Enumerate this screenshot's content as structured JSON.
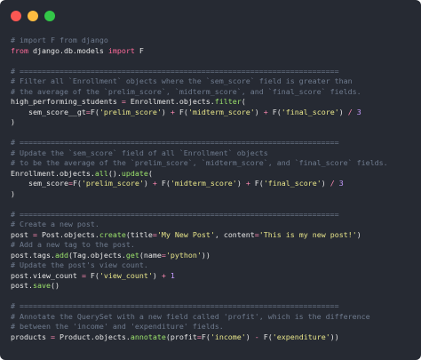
{
  "window": {
    "controls": [
      "close",
      "minimize",
      "maximize"
    ],
    "colors": {
      "close": "#fc5753",
      "minimize": "#fdbc40",
      "maximize": "#33c748",
      "background": "#262a33"
    }
  },
  "code_lines": [
    [
      {
        "t": "# import F from django",
        "c": "cm"
      }
    ],
    [
      {
        "t": "from",
        "c": "kw"
      },
      {
        "t": " django.db.models ",
        "c": "tx"
      },
      {
        "t": "import",
        "c": "kw"
      },
      {
        "t": " F",
        "c": "tx"
      }
    ],
    [],
    [
      {
        "t": "# ========================================================================",
        "c": "cm"
      }
    ],
    [
      {
        "t": "# Filter all `Enrollment` objects where the `sem_score` field is greater than",
        "c": "cm"
      }
    ],
    [
      {
        "t": "# the average of the `prelim_score`, `midterm_score`, and `final_score` fields.",
        "c": "cm"
      }
    ],
    [
      {
        "t": "high_performing_students ",
        "c": "tx"
      },
      {
        "t": "=",
        "c": "op"
      },
      {
        "t": " Enrollment.objects.",
        "c": "tx"
      },
      {
        "t": "filter",
        "c": "fn"
      },
      {
        "t": "(",
        "c": "tx"
      }
    ],
    [
      {
        "t": "    sem_score__gt",
        "c": "tx"
      },
      {
        "t": "=",
        "c": "op"
      },
      {
        "t": "F(",
        "c": "tx"
      },
      {
        "t": "'prelim_score'",
        "c": "str"
      },
      {
        "t": ") ",
        "c": "tx"
      },
      {
        "t": "+",
        "c": "op"
      },
      {
        "t": " F(",
        "c": "tx"
      },
      {
        "t": "'midterm_score'",
        "c": "str"
      },
      {
        "t": ") ",
        "c": "tx"
      },
      {
        "t": "+",
        "c": "op"
      },
      {
        "t": " F(",
        "c": "tx"
      },
      {
        "t": "'final_score'",
        "c": "str"
      },
      {
        "t": ") ",
        "c": "tx"
      },
      {
        "t": "/",
        "c": "op"
      },
      {
        "t": " ",
        "c": "tx"
      },
      {
        "t": "3",
        "c": "num"
      }
    ],
    [
      {
        "t": ")",
        "c": "tx"
      }
    ],
    [],
    [
      {
        "t": "# ========================================================================",
        "c": "cm"
      }
    ],
    [
      {
        "t": "# Update the `sem_score` field of all `Enrollment` objects",
        "c": "cm"
      }
    ],
    [
      {
        "t": "# to be the average of the `prelim_score`, `midterm_score`, and `final_score` fields.",
        "c": "cm"
      }
    ],
    [
      {
        "t": "Enrollment.objects.",
        "c": "tx"
      },
      {
        "t": "all",
        "c": "fn"
      },
      {
        "t": "().",
        "c": "tx"
      },
      {
        "t": "update",
        "c": "fn"
      },
      {
        "t": "(",
        "c": "tx"
      }
    ],
    [
      {
        "t": "    sem_score",
        "c": "tx"
      },
      {
        "t": "=",
        "c": "op"
      },
      {
        "t": "F(",
        "c": "tx"
      },
      {
        "t": "'prelim_score'",
        "c": "str"
      },
      {
        "t": ") ",
        "c": "tx"
      },
      {
        "t": "+",
        "c": "op"
      },
      {
        "t": " F(",
        "c": "tx"
      },
      {
        "t": "'midterm_score'",
        "c": "str"
      },
      {
        "t": ") ",
        "c": "tx"
      },
      {
        "t": "+",
        "c": "op"
      },
      {
        "t": " F(",
        "c": "tx"
      },
      {
        "t": "'final_score'",
        "c": "str"
      },
      {
        "t": ") ",
        "c": "tx"
      },
      {
        "t": "/",
        "c": "op"
      },
      {
        "t": " ",
        "c": "tx"
      },
      {
        "t": "3",
        "c": "num"
      }
    ],
    [
      {
        "t": ")",
        "c": "tx"
      }
    ],
    [],
    [
      {
        "t": "# ========================================================================",
        "c": "cm"
      }
    ],
    [
      {
        "t": "# Create a new post.",
        "c": "cm"
      }
    ],
    [
      {
        "t": "post ",
        "c": "tx"
      },
      {
        "t": "=",
        "c": "op"
      },
      {
        "t": " Post.objects.",
        "c": "tx"
      },
      {
        "t": "create",
        "c": "fn"
      },
      {
        "t": "(title",
        "c": "tx"
      },
      {
        "t": "=",
        "c": "op"
      },
      {
        "t": "'My New Post'",
        "c": "str"
      },
      {
        "t": ", content",
        "c": "tx"
      },
      {
        "t": "=",
        "c": "op"
      },
      {
        "t": "'This is my new post!'",
        "c": "str"
      },
      {
        "t": ")",
        "c": "tx"
      }
    ],
    [
      {
        "t": "# Add a new tag to the post.",
        "c": "cm"
      }
    ],
    [
      {
        "t": "post.tags.",
        "c": "tx"
      },
      {
        "t": "add",
        "c": "fn"
      },
      {
        "t": "(Tag.objects.",
        "c": "tx"
      },
      {
        "t": "get",
        "c": "fn"
      },
      {
        "t": "(name",
        "c": "tx"
      },
      {
        "t": "=",
        "c": "op"
      },
      {
        "t": "'python'",
        "c": "str"
      },
      {
        "t": "))",
        "c": "tx"
      }
    ],
    [
      {
        "t": "# Update the post's view count.",
        "c": "cm"
      }
    ],
    [
      {
        "t": "post.view_count ",
        "c": "tx"
      },
      {
        "t": "=",
        "c": "op"
      },
      {
        "t": " F(",
        "c": "tx"
      },
      {
        "t": "'view_count'",
        "c": "str"
      },
      {
        "t": ") ",
        "c": "tx"
      },
      {
        "t": "+",
        "c": "op"
      },
      {
        "t": " ",
        "c": "tx"
      },
      {
        "t": "1",
        "c": "num"
      }
    ],
    [
      {
        "t": "post.",
        "c": "tx"
      },
      {
        "t": "save",
        "c": "fn"
      },
      {
        "t": "()",
        "c": "tx"
      }
    ],
    [],
    [
      {
        "t": "# ========================================================================",
        "c": "cm"
      }
    ],
    [
      {
        "t": "# Annotate the QuerySet with a new field called 'profit', which is the difference",
        "c": "cm"
      }
    ],
    [
      {
        "t": "# between the 'income' and 'expenditure' fields.",
        "c": "cm"
      }
    ],
    [
      {
        "t": "products ",
        "c": "tx"
      },
      {
        "t": "=",
        "c": "op"
      },
      {
        "t": " Product.objects.",
        "c": "tx"
      },
      {
        "t": "annotate",
        "c": "fn"
      },
      {
        "t": "(profit",
        "c": "tx"
      },
      {
        "t": "=",
        "c": "op"
      },
      {
        "t": "F(",
        "c": "tx"
      },
      {
        "t": "'income'",
        "c": "str"
      },
      {
        "t": ") ",
        "c": "tx"
      },
      {
        "t": "-",
        "c": "op"
      },
      {
        "t": " F(",
        "c": "tx"
      },
      {
        "t": "'expenditure'",
        "c": "str"
      },
      {
        "t": "))",
        "c": "tx"
      }
    ]
  ]
}
